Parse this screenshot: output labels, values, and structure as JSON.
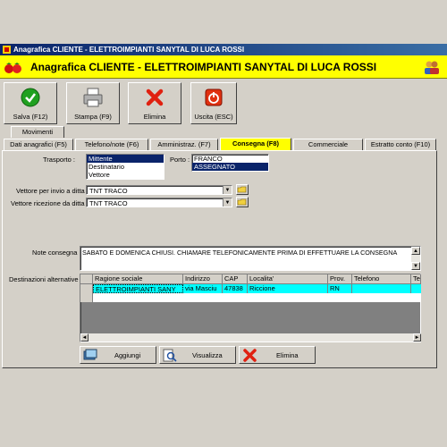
{
  "window": {
    "title": "Anagrafica CLIENTE - ELETTROIMPIANTI SANYTAL DI LUCA ROSSI"
  },
  "header": {
    "title": "Anagrafica CLIENTE - ELETTROIMPIANTI SANYTAL DI LUCA ROSSI"
  },
  "toolbar": {
    "save_label": "Salva (F12)",
    "print_label": "Stampa (F9)",
    "delete_label": "Elimina",
    "exit_label": "Uscita (ESC)"
  },
  "tabs": {
    "movimenti": "Movimenti",
    "items": [
      "Dati anagrafici (F5)",
      "Telefono/note (F6)",
      "Amministraz. (F7)",
      "Consegna (F8)",
      "Commerciale",
      "Estratto conto (F10)"
    ]
  },
  "consegna": {
    "trasporto_label": "Trasporto :",
    "trasporto_options": [
      "Mittente",
      "Destinatario",
      "Vettore"
    ],
    "porto_label": "Porto :",
    "porto_options": [
      "FRANCO",
      "ASSEGNATO"
    ],
    "vettore_invio_label": "Vettore per invio a ditta :",
    "vettore_invio_value": "TNT TRACO",
    "vettore_ricezione_label": "Vettore ricezione da ditta :",
    "vettore_ricezione_value": "TNT TRACO",
    "note_label": "Note consegna :",
    "note_value": "SABATO E DOMENICA CHIUSI. CHIAMARE TELEFONICAMENTE PRIMA DI EFFETTUARE LA CONSEGNA",
    "destinazioni_label": "Destinazioni alternative :",
    "grid_headers": [
      "Ragione sociale",
      "Indirizzo",
      "CAP",
      "Localita'",
      "Prov.",
      "Telefono",
      "Te"
    ],
    "grid_rows": [
      [
        "ELETTROIMPIANTI SANY",
        "via Masciu",
        "47838",
        "Riccione",
        "RN",
        "",
        ""
      ]
    ],
    "add_label": "Aggiungi",
    "view_label": "Visualizza",
    "delete_label": "Elimina"
  }
}
